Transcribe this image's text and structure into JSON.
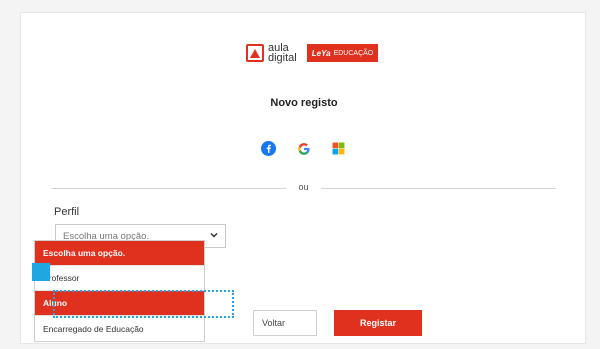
{
  "brand": {
    "aula_line1": "aula",
    "aula_line2": "digital",
    "leya_mark": "LeYa",
    "leya_text": "EDUCAÇÃO"
  },
  "form": {
    "title": "Novo registo",
    "divider_text": "ou",
    "perfil_label": "Perfil",
    "select_value": "Escolha uma opção."
  },
  "social": [
    {
      "name": "facebook-icon",
      "color": "#1877f2"
    },
    {
      "name": "google-icon",
      "color": "#4285f4"
    },
    {
      "name": "microsoft-icon",
      "color": "#f25022"
    }
  ],
  "dropdown": {
    "options": [
      {
        "label": "Escolha uma opção.",
        "selected": true
      },
      {
        "label": "Professor",
        "selected": false
      },
      {
        "label": "Aluno",
        "selected": true
      },
      {
        "label": "Encarregado de Educação",
        "selected": false
      }
    ]
  },
  "buttons": {
    "back_label": "Voltar",
    "register_label": "Registar"
  },
  "colors": {
    "accent": "#e0301e",
    "focus": "#2aa0dd"
  }
}
